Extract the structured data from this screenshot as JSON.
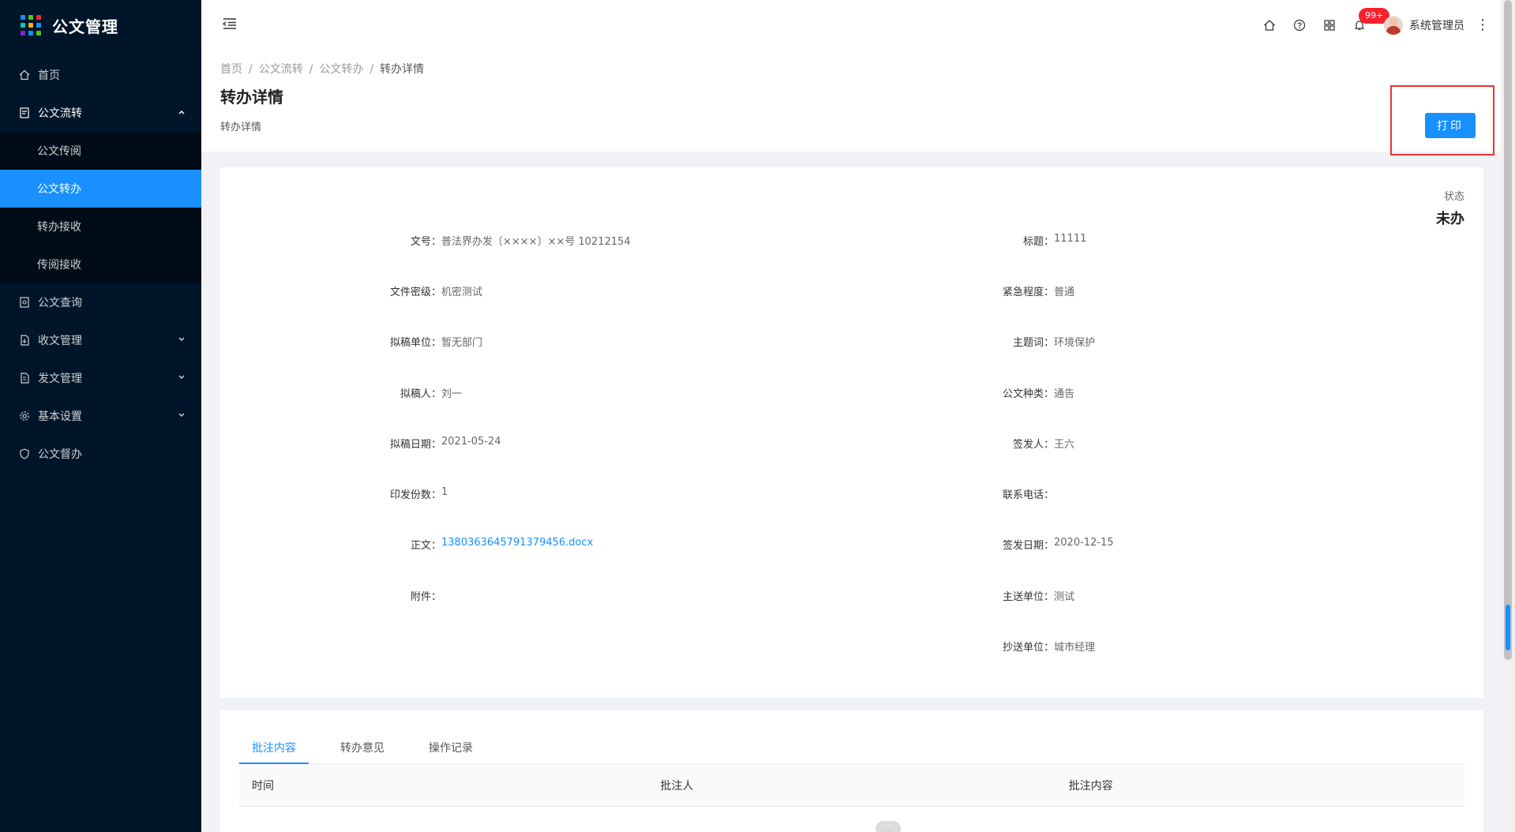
{
  "app": {
    "title": "公文管理",
    "logo_colors": [
      "#1890ff",
      "#52c41a",
      "#f5222d",
      "#13c2c2",
      "#faad14",
      "#1890ff",
      "#722ed1",
      "#1890ff",
      "#52c41a"
    ]
  },
  "sidebar": {
    "items": [
      {
        "label": "首页",
        "icon": "home-icon"
      },
      {
        "label": "公文流转",
        "icon": "document-icon",
        "open": true,
        "children": [
          {
            "label": "公文传阅"
          },
          {
            "label": "公文转办",
            "active": true
          },
          {
            "label": "转办接收"
          },
          {
            "label": "传阅接收"
          }
        ]
      },
      {
        "label": "公文查询",
        "icon": "document-search-icon"
      },
      {
        "label": "收文管理",
        "icon": "inbox-icon"
      },
      {
        "label": "发文管理",
        "icon": "send-icon"
      },
      {
        "label": "基本设置",
        "icon": "gear-icon"
      },
      {
        "label": "公文督办",
        "icon": "shield-icon"
      }
    ]
  },
  "header": {
    "notification_count": "99+",
    "user_name": "系统管理员"
  },
  "breadcrumb": [
    "首页",
    "公文流转",
    "公文转办",
    "转办详情"
  ],
  "page": {
    "title": "转办详情",
    "subtitle": "转办详情",
    "print_label": "打印"
  },
  "status": {
    "label": "状态",
    "value": "未办"
  },
  "details": {
    "left": [
      {
        "label": "文号：",
        "value": "普法界办发〔××××〕××号 10212154"
      },
      {
        "label": "文件密级：",
        "value": "机密测试"
      },
      {
        "label": "拟稿单位：",
        "value": "暂无部门"
      },
      {
        "label": "拟稿人：",
        "value": "刘一"
      },
      {
        "label": "拟稿日期：",
        "value": "2021-05-24"
      },
      {
        "label": "印发份数：",
        "value": "1"
      },
      {
        "label": "正文：",
        "value": "1380363645791379456.docx",
        "link": true
      },
      {
        "label": "附件：",
        "value": ""
      }
    ],
    "right": [
      {
        "label": "标题：",
        "value": "11111"
      },
      {
        "label": "紧急程度：",
        "value": "普通"
      },
      {
        "label": "主题词：",
        "value": "环境保护"
      },
      {
        "label": "公文种类：",
        "value": "通告"
      },
      {
        "label": "签发人：",
        "value": "王六"
      },
      {
        "label": "联系电话：",
        "value": ""
      },
      {
        "label": "签发日期：",
        "value": "2020-12-15"
      },
      {
        "label": "主送单位：",
        "value": "测试"
      },
      {
        "label": "抄送单位：",
        "value": "城市经理"
      }
    ]
  },
  "tabs": [
    "批注内容",
    "转办意见",
    "操作记录"
  ],
  "table": {
    "columns": [
      "时间",
      "批注人",
      "批注内容"
    ]
  }
}
